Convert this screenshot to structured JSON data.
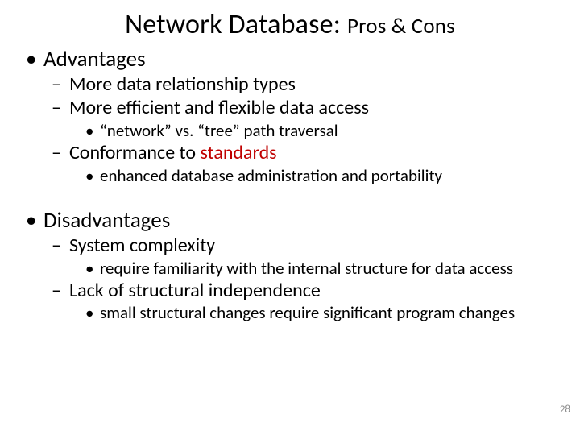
{
  "slide": {
    "title_main": "Network Database:",
    "title_sub": "Pros & Cons",
    "page_number": "28",
    "advantages": {
      "heading": "Advantages",
      "items": [
        {
          "text": "More data relationship types"
        },
        {
          "text": "More efficient and flexible data access",
          "sub": "“network” vs. “tree” path traversal"
        },
        {
          "text_pre": "Conformance to ",
          "text_emph": "standards",
          "sub": "enhanced database administration and portability"
        }
      ]
    },
    "disadvantages": {
      "heading": "Disadvantages",
      "items": [
        {
          "text": "System complexity",
          "sub": "require familiarity with the internal structure for data access"
        },
        {
          "text": "Lack of structural independence",
          "sub": "small structural changes require significant program changes"
        }
      ]
    }
  }
}
